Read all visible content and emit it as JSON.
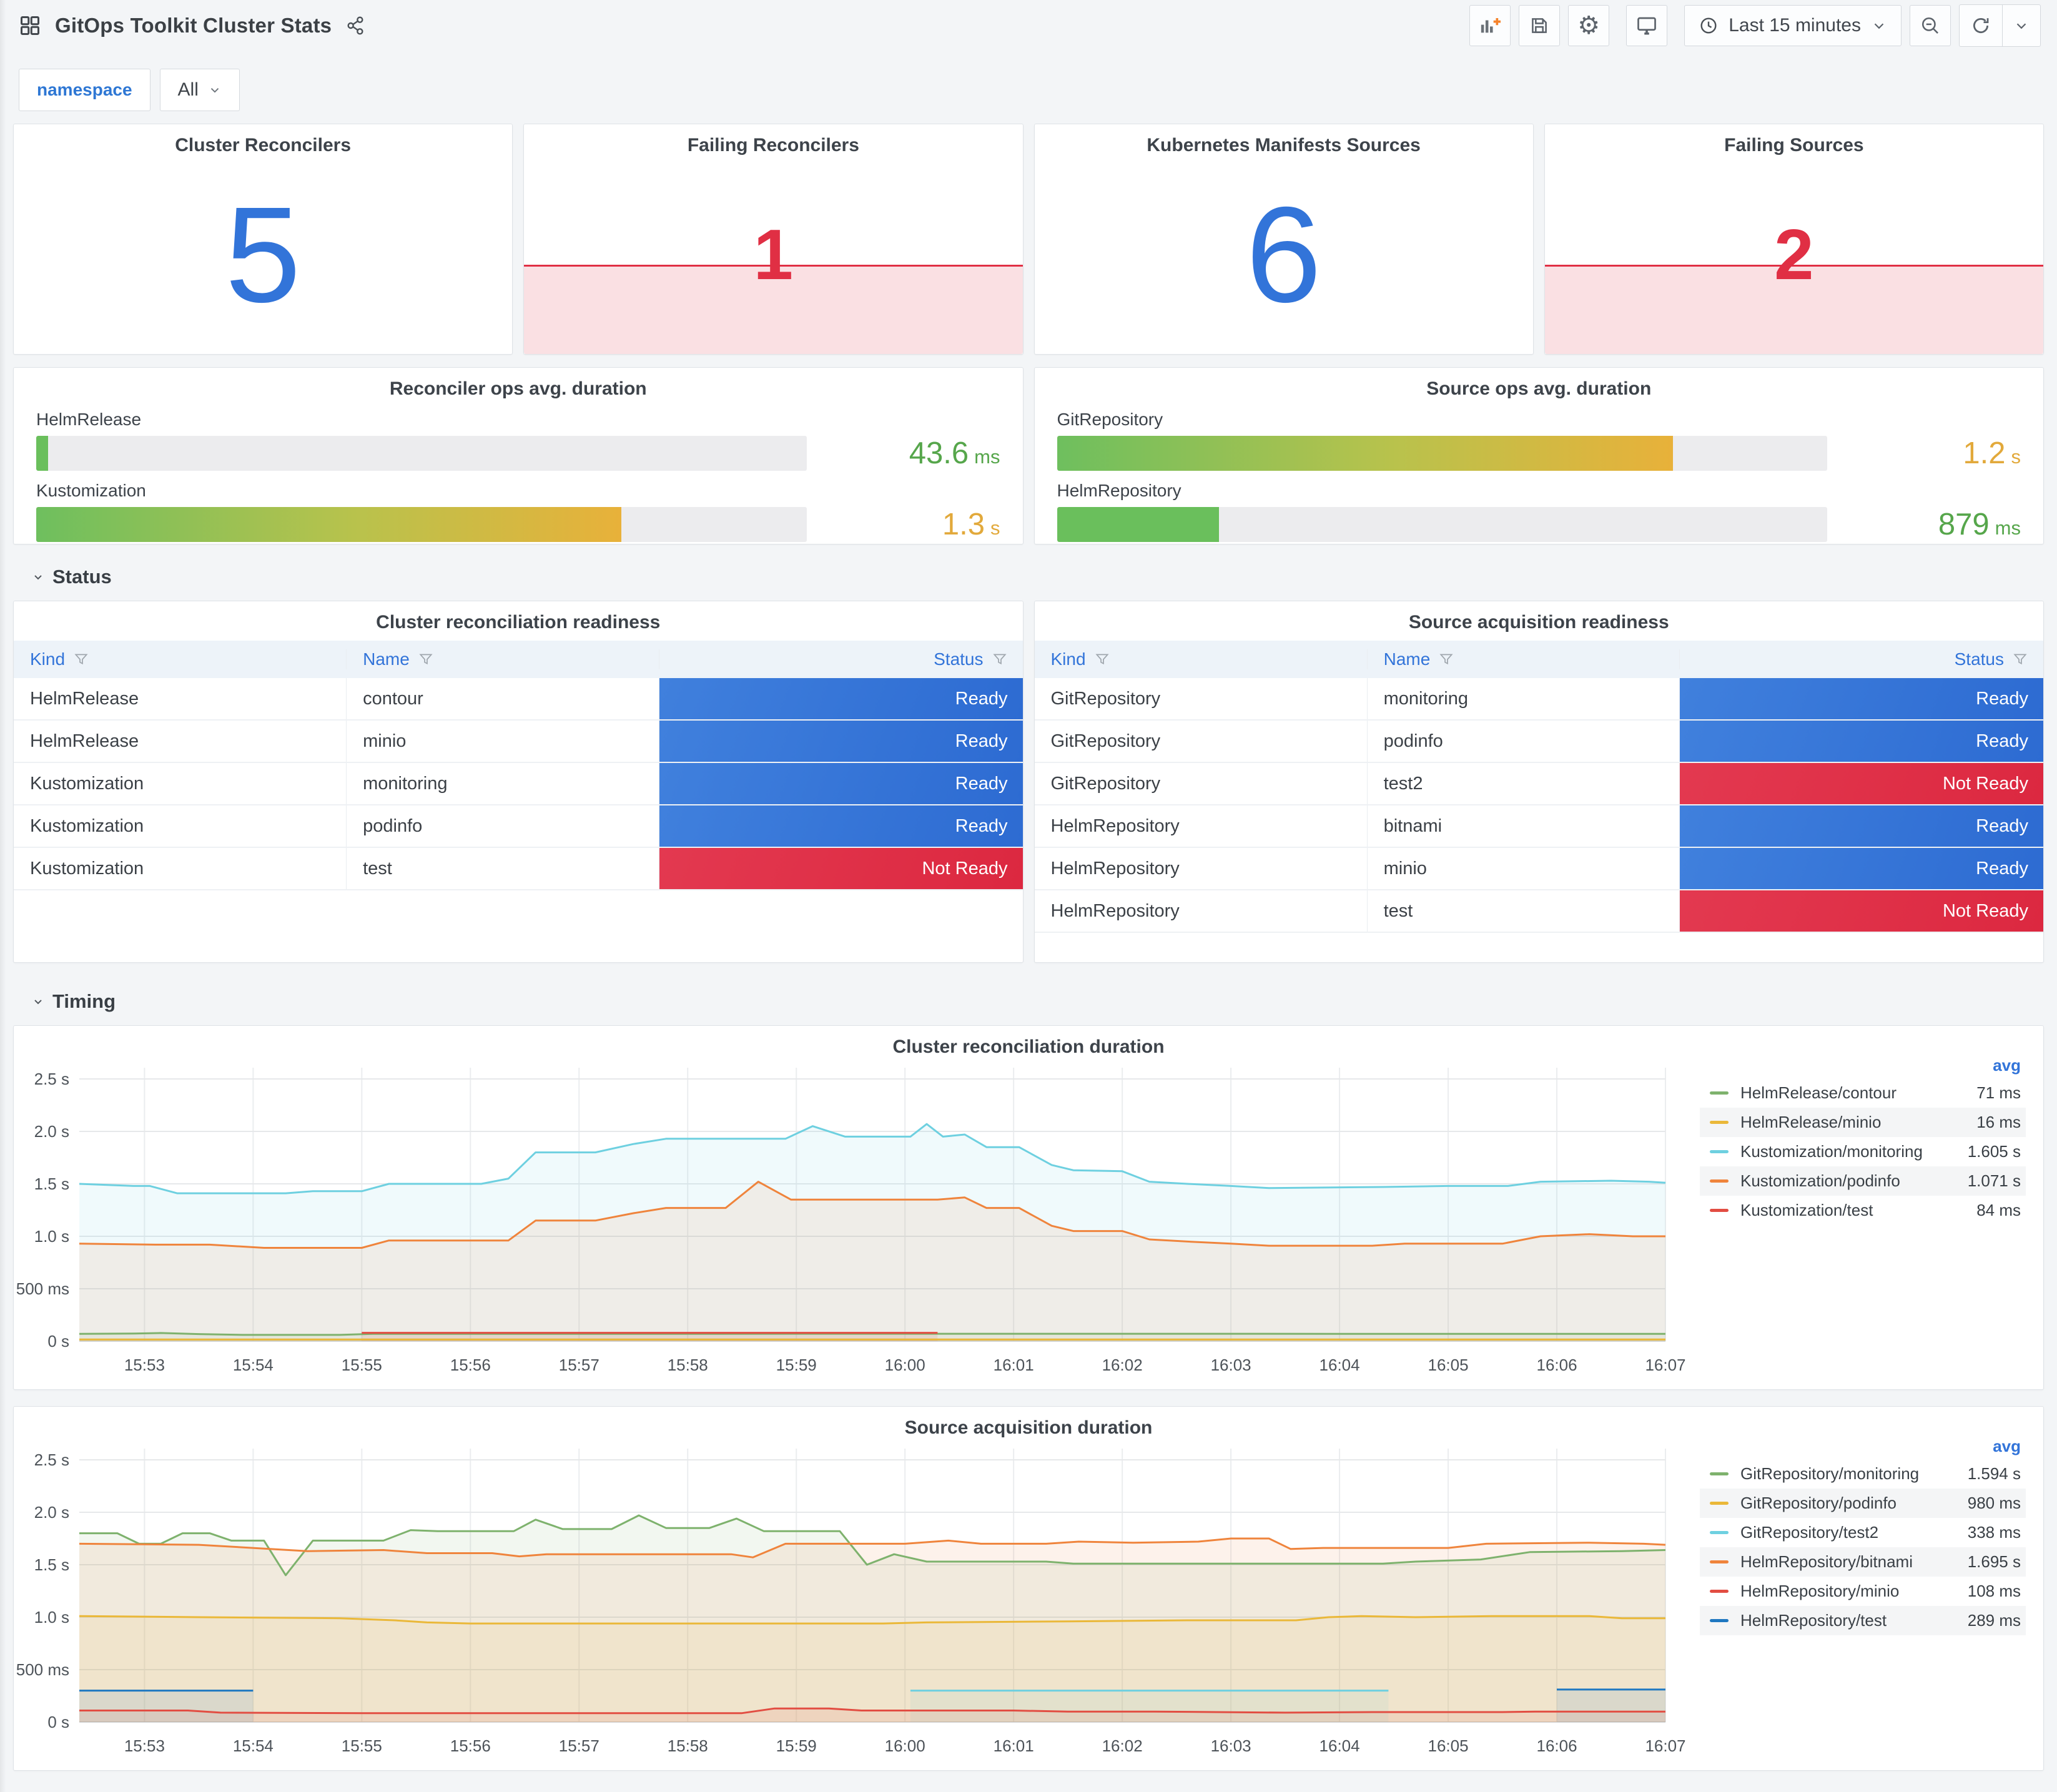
{
  "header": {
    "title": "GitOps Toolkit Cluster Stats",
    "time_range": "Last 15 minutes",
    "toolbar_icons": [
      "share-icon",
      "add-panel-icon",
      "save-dashboard-icon",
      "dashboard-settings-icon",
      "cycle-view-icon",
      "clock-icon",
      "chevron-down-icon",
      "zoom-out-icon",
      "refresh-icon"
    ]
  },
  "variables": {
    "label": "namespace",
    "value": "All"
  },
  "sections": {
    "status": "Status",
    "timing": "Timing"
  },
  "stats": [
    {
      "title": "Cluster Reconcilers",
      "value": "5",
      "color": "#3274d9",
      "failing": false
    },
    {
      "title": "Failing Reconcilers",
      "value": "1",
      "color": "#e02f44",
      "failing": true
    },
    {
      "title": "Kubernetes Manifests Sources",
      "value": "6",
      "color": "#3274d9",
      "failing": false
    },
    {
      "title": "Failing Sources",
      "value": "2",
      "color": "#e02f44",
      "failing": true
    }
  ],
  "gauges": [
    {
      "title": "Reconciler ops avg. duration",
      "rows": [
        {
          "label": "HelmRelease",
          "value": "43.6",
          "unit": "ms",
          "value_color": "#56a64b",
          "fill_pct": 1.5,
          "fill_css": "#6abf5c"
        },
        {
          "label": "Kustomization",
          "value": "1.3",
          "unit": "s",
          "value_color": "#e2a93b",
          "fill_pct": 76,
          "fill_css": "linear-gradient(90deg,#6ebf5e,#b9c24c 55%,#e8b13a)"
        }
      ]
    },
    {
      "title": "Source ops avg. duration",
      "rows": [
        {
          "label": "GitRepository",
          "value": "1.2",
          "unit": "s",
          "value_color": "#e2a93b",
          "fill_pct": 80,
          "fill_css": "linear-gradient(90deg,#6ebf5e,#b9c24c 55%,#e8b13a)"
        },
        {
          "label": "HelmRepository",
          "value": "879",
          "unit": "ms",
          "value_color": "#56a64b",
          "fill_pct": 21,
          "fill_css": "#6abf5c"
        }
      ]
    }
  ],
  "status_colors": {
    "Ready": "linear-gradient(110deg,#4080dd,#2d6bd2)",
    "Not Ready": "linear-gradient(110deg,#e33950,#dc2840)"
  },
  "tables": [
    {
      "title": "Cluster reconciliation readiness",
      "columns": [
        "Kind",
        "Name",
        "Status"
      ],
      "rows": [
        [
          "HelmRelease",
          "contour",
          "Ready"
        ],
        [
          "HelmRelease",
          "minio",
          "Ready"
        ],
        [
          "Kustomization",
          "monitoring",
          "Ready"
        ],
        [
          "Kustomization",
          "podinfo",
          "Ready"
        ],
        [
          "Kustomization",
          "test",
          "Not Ready"
        ]
      ]
    },
    {
      "title": "Source acquisition readiness",
      "columns": [
        "Kind",
        "Name",
        "Status"
      ],
      "rows": [
        [
          "GitRepository",
          "monitoring",
          "Ready"
        ],
        [
          "GitRepository",
          "podinfo",
          "Ready"
        ],
        [
          "GitRepository",
          "test2",
          "Not Ready"
        ],
        [
          "HelmRepository",
          "bitnami",
          "Ready"
        ],
        [
          "HelmRepository",
          "minio",
          "Ready"
        ],
        [
          "HelmRepository",
          "test",
          "Not Ready"
        ]
      ]
    }
  ],
  "chart_data": [
    {
      "type": "area",
      "title": "Cluster reconciliation duration",
      "legend_header": "avg",
      "legend_position": "right",
      "grid": true,
      "fill_opacity": 0.1,
      "x_unit": "minutes after 15:52",
      "x_domain": [
        0.4,
        15
      ],
      "x_tick_labels": [
        "15:53",
        "15:54",
        "15:55",
        "15:56",
        "15:57",
        "15:58",
        "15:59",
        "16:00",
        "16:01",
        "16:02",
        "16:03",
        "16:04",
        "16:05",
        "16:06",
        "16:07"
      ],
      "y_max_seconds": 2.5,
      "y_tick_labels": [
        "0 s",
        "500 ms",
        "1.0 s",
        "1.5 s",
        "2.0 s",
        "2.5 s"
      ],
      "series": [
        {
          "name": "HelmRelease/contour",
          "color": "#7eb26d",
          "avg": "71 ms",
          "points": [
            [
              0.4,
              0.07
            ],
            [
              0.9,
              0.073
            ],
            [
              1.15,
              0.078
            ],
            [
              1.5,
              0.068
            ],
            [
              1.9,
              0.06
            ],
            [
              2.8,
              0.06
            ],
            [
              3.1,
              0.07
            ],
            [
              6.0,
              0.07
            ],
            [
              9.0,
              0.071
            ],
            [
              12.0,
              0.07
            ],
            [
              15,
              0.07
            ]
          ]
        },
        {
          "name": "HelmRelease/minio",
          "color": "#eab839",
          "avg": "16 ms",
          "points": [
            [
              0.4,
              0.016
            ],
            [
              15,
              0.016
            ]
          ]
        },
        {
          "name": "Kustomization/monitoring",
          "color": "#6ed0e0",
          "avg": "1.605 s",
          "points": [
            [
              0.4,
              1.5
            ],
            [
              0.9,
              1.48
            ],
            [
              1.05,
              1.48
            ],
            [
              1.3,
              1.41
            ],
            [
              2.3,
              1.41
            ],
            [
              2.55,
              1.43
            ],
            [
              3.0,
              1.43
            ],
            [
              3.25,
              1.5
            ],
            [
              4.1,
              1.5
            ],
            [
              4.35,
              1.55
            ],
            [
              4.6,
              1.8
            ],
            [
              5.15,
              1.8
            ],
            [
              5.5,
              1.88
            ],
            [
              5.8,
              1.93
            ],
            [
              6.9,
              1.93
            ],
            [
              7.15,
              2.05
            ],
            [
              7.45,
              1.95
            ],
            [
              8.05,
              1.95
            ],
            [
              8.2,
              2.07
            ],
            [
              8.35,
              1.95
            ],
            [
              8.55,
              1.97
            ],
            [
              8.75,
              1.85
            ],
            [
              9.05,
              1.85
            ],
            [
              9.35,
              1.68
            ],
            [
              9.55,
              1.63
            ],
            [
              10.0,
              1.62
            ],
            [
              10.25,
              1.52
            ],
            [
              10.6,
              1.5
            ],
            [
              11.0,
              1.48
            ],
            [
              11.35,
              1.46
            ],
            [
              12.4,
              1.47
            ],
            [
              13.0,
              1.48
            ],
            [
              13.55,
              1.48
            ],
            [
              13.85,
              1.52
            ],
            [
              14.5,
              1.53
            ],
            [
              14.85,
              1.52
            ],
            [
              15,
              1.51
            ]
          ]
        },
        {
          "name": "Kustomization/podinfo",
          "color": "#ef843c",
          "avg": "1.071 s",
          "points": [
            [
              0.4,
              0.93
            ],
            [
              1.1,
              0.92
            ],
            [
              1.6,
              0.92
            ],
            [
              2.1,
              0.89
            ],
            [
              3.0,
              0.89
            ],
            [
              3.25,
              0.96
            ],
            [
              4.35,
              0.96
            ],
            [
              4.6,
              1.15
            ],
            [
              5.15,
              1.15
            ],
            [
              5.5,
              1.22
            ],
            [
              5.8,
              1.27
            ],
            [
              6.35,
              1.27
            ],
            [
              6.65,
              1.52
            ],
            [
              6.95,
              1.35
            ],
            [
              8.3,
              1.35
            ],
            [
              8.55,
              1.37
            ],
            [
              8.75,
              1.27
            ],
            [
              9.05,
              1.27
            ],
            [
              9.35,
              1.1
            ],
            [
              9.55,
              1.05
            ],
            [
              10.0,
              1.05
            ],
            [
              10.25,
              0.97
            ],
            [
              10.6,
              0.95
            ],
            [
              11.0,
              0.93
            ],
            [
              11.35,
              0.91
            ],
            [
              12.3,
              0.91
            ],
            [
              12.6,
              0.93
            ],
            [
              13.5,
              0.93
            ],
            [
              13.85,
              1.0
            ],
            [
              14.3,
              1.02
            ],
            [
              14.7,
              1.0
            ],
            [
              15,
              1.0
            ]
          ]
        },
        {
          "name": "Kustomization/test",
          "color": "#e24d42",
          "avg": "84 ms",
          "points": [
            [
              3.0,
              0.08
            ],
            [
              8.3,
              0.08
            ]
          ]
        }
      ]
    },
    {
      "type": "area",
      "title": "Source acquisition duration",
      "legend_header": "avg",
      "legend_position": "right",
      "grid": true,
      "fill_opacity": 0.1,
      "x_unit": "minutes after 15:52",
      "x_domain": [
        0.4,
        15
      ],
      "x_tick_labels": [
        "15:53",
        "15:54",
        "15:55",
        "15:56",
        "15:57",
        "15:58",
        "15:59",
        "16:00",
        "16:01",
        "16:02",
        "16:03",
        "16:04",
        "16:05",
        "16:06",
        "16:07"
      ],
      "y_max_seconds": 2.5,
      "y_tick_labels": [
        "0 s",
        "500 ms",
        "1.0 s",
        "1.5 s",
        "2.0 s",
        "2.5 s"
      ],
      "series": [
        {
          "name": "GitRepository/monitoring",
          "color": "#7eb26d",
          "avg": "1.594 s",
          "points": [
            [
              0.4,
              1.8
            ],
            [
              0.75,
              1.8
            ],
            [
              0.95,
              1.7
            ],
            [
              1.15,
              1.7
            ],
            [
              1.35,
              1.8
            ],
            [
              1.6,
              1.8
            ],
            [
              1.8,
              1.73
            ],
            [
              2.1,
              1.73
            ],
            [
              2.3,
              1.4
            ],
            [
              2.55,
              1.73
            ],
            [
              3.2,
              1.73
            ],
            [
              3.45,
              1.83
            ],
            [
              3.7,
              1.82
            ],
            [
              4.4,
              1.82
            ],
            [
              4.6,
              1.93
            ],
            [
              4.85,
              1.84
            ],
            [
              5.3,
              1.84
            ],
            [
              5.55,
              1.97
            ],
            [
              5.8,
              1.85
            ],
            [
              6.2,
              1.85
            ],
            [
              6.45,
              1.94
            ],
            [
              6.7,
              1.82
            ],
            [
              7.4,
              1.82
            ],
            [
              7.65,
              1.5
            ],
            [
              7.9,
              1.6
            ],
            [
              8.2,
              1.53
            ],
            [
              9.3,
              1.53
            ],
            [
              9.55,
              1.51
            ],
            [
              12.4,
              1.51
            ],
            [
              12.7,
              1.53
            ],
            [
              13.3,
              1.55
            ],
            [
              13.75,
              1.62
            ],
            [
              14.6,
              1.63
            ],
            [
              15,
              1.64
            ]
          ]
        },
        {
          "name": "GitRepository/podinfo",
          "color": "#eab839",
          "avg": "980 ms",
          "points": [
            [
              0.4,
              1.01
            ],
            [
              1.5,
              1.0
            ],
            [
              2.8,
              0.99
            ],
            [
              3.3,
              0.97
            ],
            [
              3.6,
              0.95
            ],
            [
              4.0,
              0.94
            ],
            [
              7.8,
              0.94
            ],
            [
              8.2,
              0.95
            ],
            [
              9.5,
              0.96
            ],
            [
              10.6,
              0.97
            ],
            [
              11.6,
              0.97
            ],
            [
              11.9,
              1.0
            ],
            [
              12.2,
              1.01
            ],
            [
              12.7,
              1.0
            ],
            [
              13.4,
              1.01
            ],
            [
              14.3,
              1.01
            ],
            [
              14.6,
              0.99
            ],
            [
              15,
              0.99
            ]
          ]
        },
        {
          "name": "GitRepository/test2",
          "color": "#6ed0e0",
          "avg": "338 ms",
          "points": [
            [
              8.05,
              0.3
            ],
            [
              12.45,
              0.3
            ]
          ]
        },
        {
          "name": "HelmRepository/bitnami",
          "color": "#ef843c",
          "avg": "1.695 s",
          "points": [
            [
              0.4,
              1.7
            ],
            [
              1.5,
              1.69
            ],
            [
              2.5,
              1.63
            ],
            [
              3.2,
              1.64
            ],
            [
              3.6,
              1.61
            ],
            [
              4.2,
              1.61
            ],
            [
              4.45,
              1.58
            ],
            [
              4.7,
              1.6
            ],
            [
              6.4,
              1.6
            ],
            [
              6.6,
              1.57
            ],
            [
              6.9,
              1.7
            ],
            [
              8.0,
              1.7
            ],
            [
              8.4,
              1.73
            ],
            [
              8.7,
              1.7
            ],
            [
              9.3,
              1.7
            ],
            [
              9.6,
              1.72
            ],
            [
              10.1,
              1.71
            ],
            [
              10.7,
              1.72
            ],
            [
              11.0,
              1.75
            ],
            [
              11.35,
              1.75
            ],
            [
              11.55,
              1.65
            ],
            [
              11.85,
              1.66
            ],
            [
              13.0,
              1.66
            ],
            [
              13.35,
              1.7
            ],
            [
              14.3,
              1.71
            ],
            [
              14.8,
              1.7
            ],
            [
              15,
              1.69
            ]
          ]
        },
        {
          "name": "HelmRepository/minio",
          "color": "#e24d42",
          "avg": "108 ms",
          "points": [
            [
              0.4,
              0.11
            ],
            [
              1.4,
              0.11
            ],
            [
              1.7,
              0.09
            ],
            [
              3.0,
              0.085
            ],
            [
              6.5,
              0.085
            ],
            [
              6.8,
              0.13
            ],
            [
              7.3,
              0.13
            ],
            [
              7.6,
              0.11
            ],
            [
              9.0,
              0.11
            ],
            [
              9.5,
              0.1
            ],
            [
              10.3,
              0.1
            ],
            [
              11.5,
              0.09
            ],
            [
              12.3,
              0.095
            ],
            [
              13.5,
              0.095
            ],
            [
              13.8,
              0.1
            ],
            [
              15,
              0.1
            ]
          ]
        },
        {
          "name": "HelmRepository/test",
          "color": "#1f78c1",
          "avg": "289 ms",
          "points": [
            [
              0.4,
              0.3
            ],
            [
              2.0,
              0.3
            ],
            null,
            [
              14.0,
              0.31
            ],
            [
              15,
              0.31
            ]
          ]
        }
      ]
    }
  ]
}
